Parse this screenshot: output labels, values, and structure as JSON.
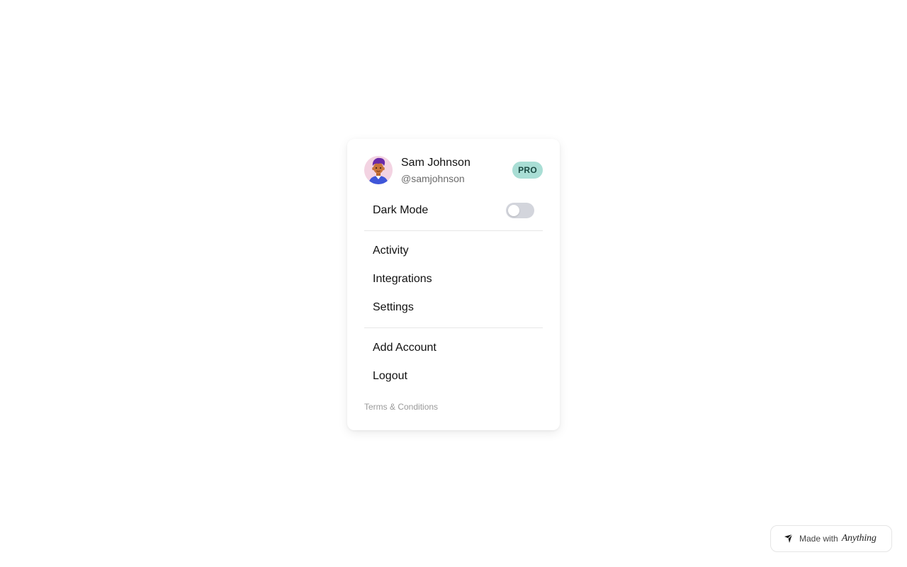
{
  "user": {
    "name": "Sam Johnson",
    "handle": "@samjohnson",
    "plan_badge": "PRO",
    "avatar_icon": "person-avatar"
  },
  "dark_mode": {
    "label": "Dark Mode",
    "enabled": false
  },
  "menu_items": [
    {
      "label": "Activity"
    },
    {
      "label": "Integrations"
    },
    {
      "label": "Settings"
    }
  ],
  "account_items": [
    {
      "label": "Add Account"
    },
    {
      "label": "Logout"
    }
  ],
  "footer": {
    "terms_label": "Terms & Conditions"
  },
  "made_with": {
    "prefix": "Made with",
    "brand": "Anything",
    "icon": "anything-logo-icon"
  },
  "colors": {
    "badge_bg": "#a9ded5",
    "badge_text": "#1b4a43",
    "toggle_off": "#d3d5dc",
    "avatar_bg": "#f3d3e2"
  }
}
